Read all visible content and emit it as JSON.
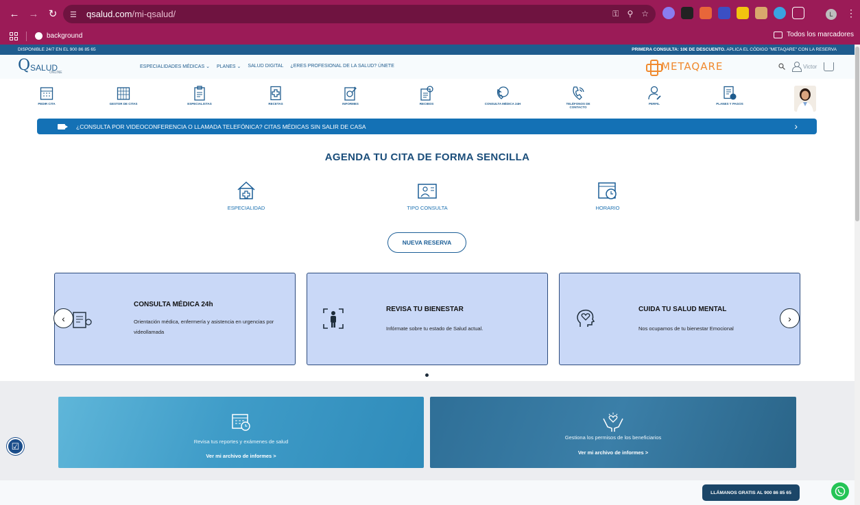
{
  "browser": {
    "url_host": "qsalud.com",
    "url_path": "/mi-qsalud/",
    "bookmark": "background",
    "all_bookmarks": "Todos los marcadores",
    "profile_initial": "L"
  },
  "topstrip": {
    "left": "DISPONIBLE 24/7 EN EL 900 86 85 65",
    "right_bold": "PRIMERA CONSULTA: 10€ DE DESCUENTO.",
    "right_rest": " APLICA EL CÓDIGO \"METAQARE\" CON LA RESERVA"
  },
  "header": {
    "logo_mark": "Q",
    "logo_text": "SALUD",
    "logo_sub": "ONLINE",
    "menu": [
      "ESPECIALIDADES MÉDICAS",
      "PLANES",
      "SALUD DIGITAL",
      "¿ERES PROFESIONAL DE LA SALUD? ÚNETE"
    ],
    "partner": "METAQARE",
    "user_name": "Victor"
  },
  "quicknav": [
    {
      "label": "PEDIR CITA",
      "icon": "calendar-icon"
    },
    {
      "label": "GESTOR DE CITAS",
      "icon": "calendar-grid-icon"
    },
    {
      "label": "ESPECIALISTAS",
      "icon": "clipboard-icon"
    },
    {
      "label": "RECETAS",
      "icon": "prescription-icon"
    },
    {
      "label": "INFORMES",
      "icon": "report-icon"
    },
    {
      "label": "RECIBOS",
      "icon": "receipt-icon"
    },
    {
      "label": "CONSULTA MÉDICA 24H",
      "icon": "24h-phone-icon"
    },
    {
      "label": "TELÉFONOS DE CONTACTO",
      "icon": "phone-icon"
    },
    {
      "label": "PERFIL",
      "icon": "profile-icon"
    },
    {
      "label": "PLANES Y PAGOS",
      "icon": "plans-icon"
    }
  ],
  "banner": "¿CONSULTA POR VIDEOCONFERENCIA O LLAMADA TELEFÓNICA?  CITAS MÉDICAS SIN SALIR DE CASA",
  "agenda": {
    "title": "AGENDA TU CITA DE FORMA SENCILLA",
    "steps": [
      "ESPECIALIDAD",
      "TIPO CONSULTA",
      "HORARIO"
    ],
    "button": "NUEVA RESERVA"
  },
  "cards": [
    {
      "title": "CONSULTA MÉDICA 24h",
      "desc": "Orientación médica, enfermería y asistencia en urgencias por videollamada"
    },
    {
      "title": "REVISA TU BIENESTAR",
      "desc": "Infórmate sobre tu estado de Salud actual."
    },
    {
      "title": "CUIDA TU SALUD MENTAL",
      "desc": "Nos ocupamos de tu bienestar Emocional"
    }
  ],
  "promos": [
    {
      "text": "Revisa tus reportes y exámenes de salud",
      "link": "Ver mi archivo de informes  >"
    },
    {
      "text": "Gestiona los permisos de los beneficiarios",
      "link": "Ver mi archivo de informes  >"
    }
  ],
  "call_button": "LLÁMANOS GRATIS AL 900 86 85 65",
  "colors": {
    "brand_dark": "#1a4d7a",
    "brand_blue": "#1471b5",
    "browser_frame": "#9b1b57",
    "card_bg": "#c9d8f7",
    "partner_orange": "#f08a2e",
    "whatsapp": "#25c456"
  }
}
